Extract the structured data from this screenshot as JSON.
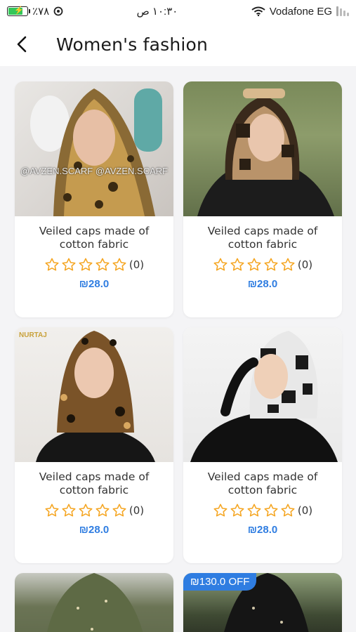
{
  "status_bar": {
    "battery_text": "٪٧٨",
    "time": "١٠:٣٠ ص",
    "carrier": "Vodafone EG"
  },
  "header": {
    "title": "Women's fashion"
  },
  "products": [
    {
      "title": "Veiled caps made of cotton fabric",
      "rating_count": "(0)",
      "price": "₪28.0",
      "watermark": "@AVZEN.SCARF @AVZEN.SCARF",
      "image": "leopard-print-hijab"
    },
    {
      "title": "Veiled caps made of cotton fabric",
      "rating_count": "(0)",
      "price": "₪28.0",
      "image": "patterned-hijab-leather-jacket"
    },
    {
      "title": "Veiled caps made of cotton fabric",
      "rating_count": "(0)",
      "price": "₪28.0",
      "watermark": "NURTAJ",
      "image": "leopard-print-hijab-black-top"
    },
    {
      "title": "Veiled caps made of cotton fabric",
      "rating_count": "(0)",
      "price": "₪28.0",
      "image": "black-white-print-hijab"
    },
    {
      "image": "olive-embellished-dress"
    },
    {
      "badge": "₪130.0 OFF",
      "image": "black-embellished-abaya"
    }
  ],
  "colors": {
    "accent": "#2f7de1",
    "star": "#f5a623",
    "card_bg": "#ffffff",
    "page_bg": "#f4f4f6"
  }
}
